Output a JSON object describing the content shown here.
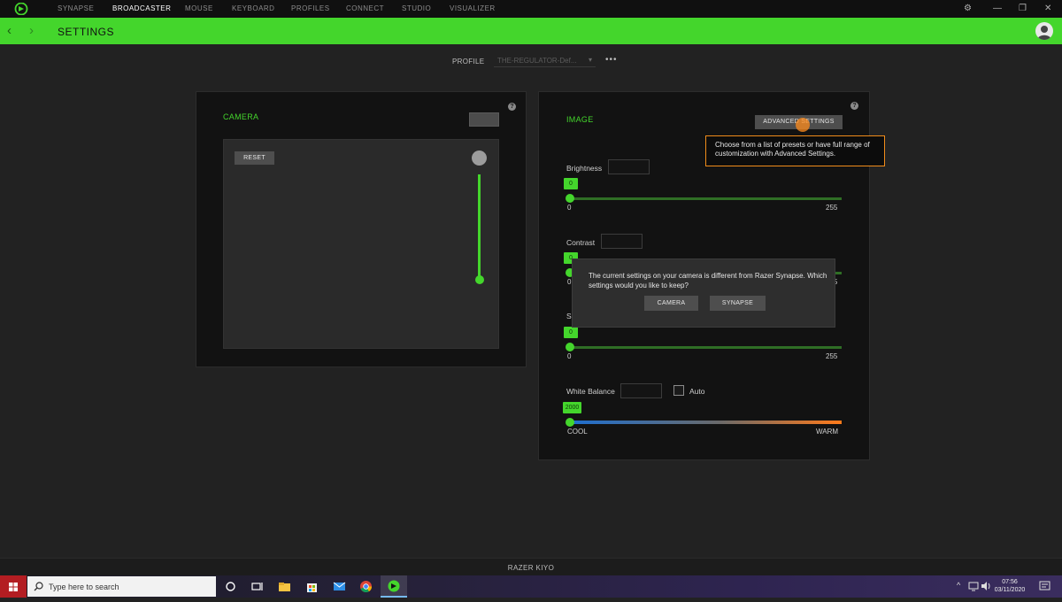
{
  "nav": {
    "items": [
      "SYNAPSE",
      "BROADCASTER",
      "MOUSE",
      "KEYBOARD",
      "PROFILES",
      "CONNECT",
      "STUDIO",
      "VISUALIZER"
    ],
    "active": "BROADCASTER"
  },
  "header": {
    "title": "SETTINGS"
  },
  "profile": {
    "label": "PROFILE",
    "value": "THE-REGULATOR-Def...",
    "more": "•••"
  },
  "camera_panel": {
    "title": "CAMERA",
    "reset_label": "RESET",
    "zoom_fraction": 0.0
  },
  "image_panel": {
    "title": "IMAGE",
    "advanced_label": "ADVANCED SETTINGS",
    "tooltip": "Choose from a list of presets or have full range of customization with Advanced Settings.",
    "brightness": {
      "label": "Brightness",
      "value": "0",
      "min": "0",
      "max": "255"
    },
    "contrast": {
      "label": "Contrast",
      "value": "0",
      "min": "0",
      "max": "255"
    },
    "saturation": {
      "label_partial": "Sa",
      "value": "0",
      "min": "0",
      "max": "255"
    },
    "white_balance": {
      "label": "White Balance",
      "auto_label": "Auto",
      "value": "2000",
      "min_label": "COOL",
      "max_label": "WARM"
    }
  },
  "dialog": {
    "message": "The current settings on your camera is different from Razer Synapse. Which settings would you like to keep?",
    "camera_label": "CAMERA",
    "synapse_label": "SYNAPSE"
  },
  "device": {
    "name": "RAZER KIYO"
  },
  "taskbar": {
    "search_placeholder": "Type here to search",
    "time": "07:56",
    "date": "03/11/2020"
  },
  "colors": {
    "accent": "#44d62c",
    "tooltip_border": "#f08c1a",
    "background": "#222222",
    "panel": "#121212"
  }
}
